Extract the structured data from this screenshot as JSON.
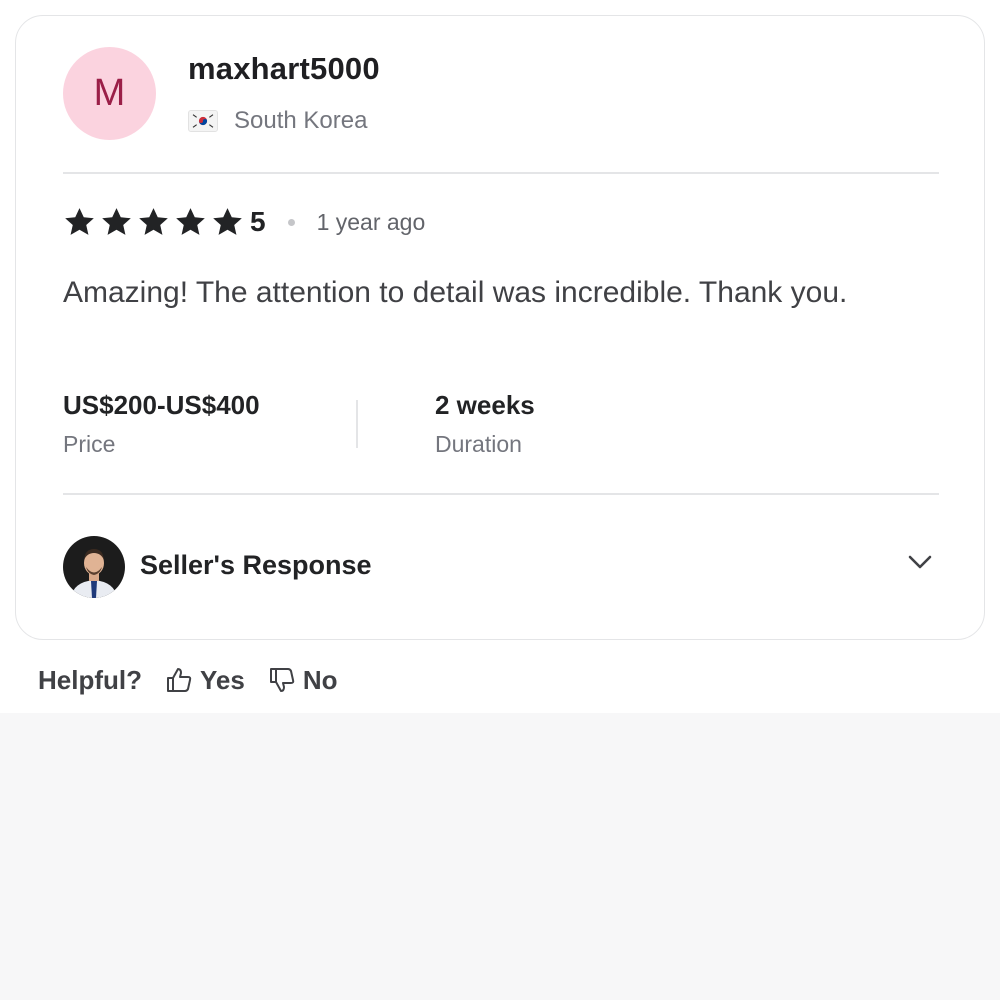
{
  "review": {
    "avatar_initial": "M",
    "username": "maxhart5000",
    "country": "South Korea",
    "rating": 5,
    "rating_label": "5",
    "time_ago": "1 year ago",
    "text": "Amazing! The attention to detail was incredible. Thank you.",
    "price": {
      "value": "US$200-US$400",
      "label": "Price"
    },
    "duration": {
      "value": "2 weeks",
      "label": "Duration"
    },
    "seller_response_label": "Seller's Response"
  },
  "helpful": {
    "label": "Helpful?",
    "yes_label": "Yes",
    "no_label": "No"
  },
  "colors": {
    "avatar_bg": "#fbd3df",
    "avatar_text": "#9b1f48",
    "star": "#222325",
    "page_bottom_bg": "#f7f7f8"
  },
  "icons": [
    "south-korea-flag-icon",
    "star-icon",
    "chevron-down-icon",
    "thumbs-up-icon",
    "thumbs-down-icon"
  ]
}
